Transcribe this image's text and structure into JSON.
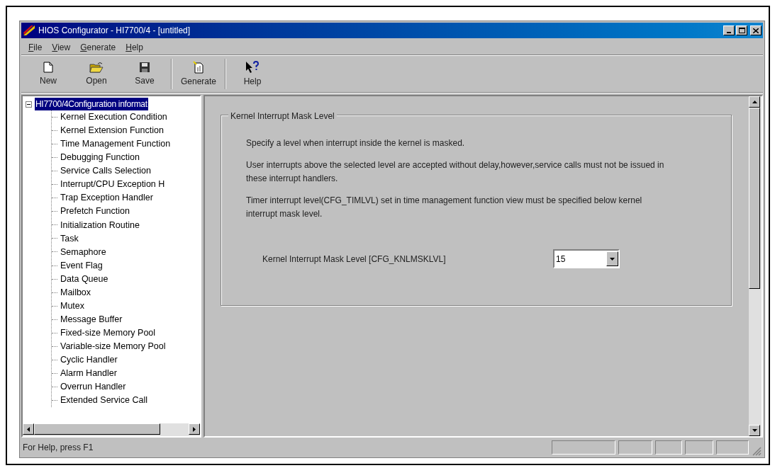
{
  "window": {
    "title": "HIOS Configurator - HI7700/4 - [untitled]"
  },
  "menu": [
    "File",
    "View",
    "Generate",
    "Help"
  ],
  "toolbar": [
    {
      "kind": "new",
      "label": "New"
    },
    {
      "kind": "open",
      "label": "Open"
    },
    {
      "kind": "save",
      "label": "Save"
    },
    {
      "kind": "generate",
      "label": "Generate"
    },
    {
      "kind": "help",
      "label": "Help"
    }
  ],
  "tree": {
    "label": "HI7700/4Configuration informat",
    "selected": true,
    "expanded": true,
    "children": [
      {
        "label": "Kernel Execution Condition",
        "selected": false
      },
      {
        "label": "Kernel Extension Function",
        "selected": false
      },
      {
        "label": "Time Management Function",
        "selected": false
      },
      {
        "label": "Debugging Function",
        "selected": false
      },
      {
        "label": "Service Calls Selection",
        "selected": false
      },
      {
        "label": "Interrupt/CPU Exception H",
        "selected": false
      },
      {
        "label": "Trap Exception Handler",
        "selected": false
      },
      {
        "label": "Prefetch Function",
        "selected": false
      },
      {
        "label": "Initialization Routine",
        "selected": false
      },
      {
        "label": "Task",
        "selected": false
      },
      {
        "label": "Semaphore",
        "selected": false
      },
      {
        "label": "Event Flag",
        "selected": false
      },
      {
        "label": "Data Queue",
        "selected": false
      },
      {
        "label": "Mailbox",
        "selected": false
      },
      {
        "label": "Mutex",
        "selected": false
      },
      {
        "label": "Message Buffer",
        "selected": false
      },
      {
        "label": "Fixed-size Memory Pool",
        "selected": false
      },
      {
        "label": "Variable-size Memory Pool",
        "selected": false
      },
      {
        "label": "Cyclic Handler",
        "selected": false
      },
      {
        "label": "Alarm Handler",
        "selected": false
      },
      {
        "label": "Overrun Handler",
        "selected": false
      },
      {
        "label": "Extended Service Call",
        "selected": false
      }
    ]
  },
  "group": {
    "title": "Kernel Interrupt Mask Level",
    "paragraphs": [
      "Specify a level when interrupt inside the kernel is masked.",
      "User interrupts above the selected level are accepted without delay,however,service calls must not be issued in these interrupt handlers.",
      "Timer interrupt level(CFG_TIMLVL) set in time management function view must be specified below kernel interrupt mask level."
    ],
    "field": {
      "label": "Kernel Interrupt Mask Level [CFG_KNLMSKLVL]",
      "value": "15"
    }
  },
  "status_bar": {
    "text": "For Help, press F1"
  }
}
